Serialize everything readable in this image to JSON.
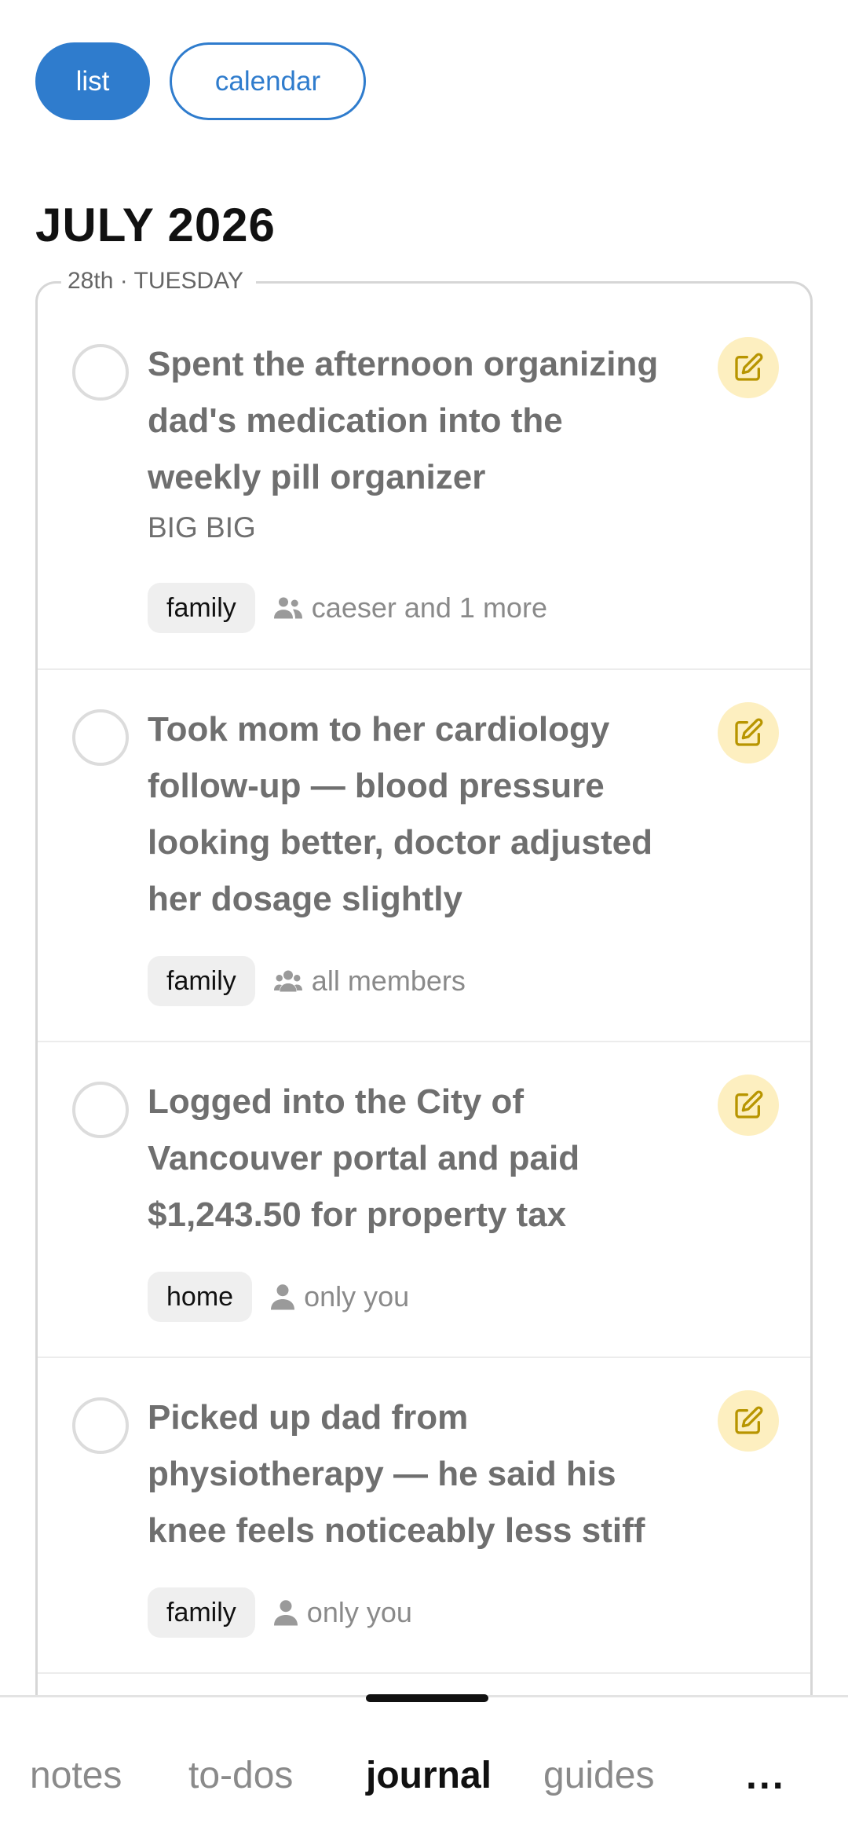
{
  "view_toggle": {
    "list": "list",
    "calendar": "calendar"
  },
  "month_title": "JULY 2026",
  "day_label": "28th · TUESDAY",
  "entries": [
    {
      "lines": [
        "Spent the afternoon organizing",
        "dad's medication into the",
        "weekly pill organizer"
      ],
      "subtitle": "BIG BIG",
      "tag": "family",
      "share_icon": "users-icon",
      "share": "caeser and 1 more"
    },
    {
      "lines": [
        "Took mom to her cardiology",
        "follow-up — blood pressure",
        "looking better, doctor adjusted",
        "her dosage slightly"
      ],
      "tag": "family",
      "share_icon": "group-icon",
      "share": "all members"
    },
    {
      "lines": [
        "Logged into the City of",
        "Vancouver portal and paid",
        "$1,243.50 for property tax"
      ],
      "tag": "home",
      "share_icon": "user-icon",
      "share": "only you"
    },
    {
      "lines": [
        "Picked up dad from",
        "physiotherapy — he said his",
        "knee feels noticeably less stiff"
      ],
      "tag": "family",
      "share_icon": "user-icon",
      "share": "only you"
    }
  ],
  "bottom_nav": {
    "items": [
      "notes",
      "to-dos",
      "journal",
      "guides"
    ],
    "active": "journal",
    "more": "..."
  },
  "colors": {
    "accent": "#2f7ccd",
    "edit_bg": "#fdefc0",
    "edit_icon": "#b89500",
    "tag_bg": "#efefef"
  }
}
